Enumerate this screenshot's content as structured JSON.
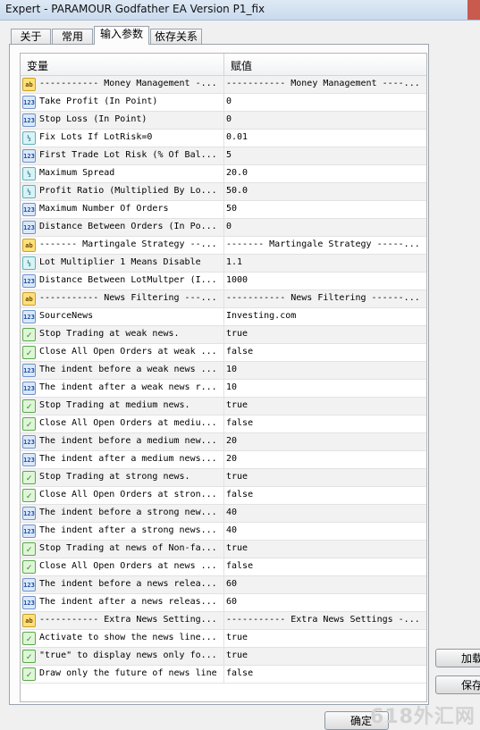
{
  "window": {
    "title": "Expert - PARAMOUR Godfather EA Version P1_fix"
  },
  "tabs": [
    {
      "label": "关于"
    },
    {
      "label": "常用"
    },
    {
      "label": "输入参数",
      "active": true
    },
    {
      "label": "依存关系"
    }
  ],
  "grid": {
    "col_variable": "变量",
    "col_value": "赋值",
    "rows": [
      {
        "icon": "ab",
        "name": "----------- Money Management -...",
        "value": "----------- Money Management ----..."
      },
      {
        "icon": "123",
        "name": "Take Profit (In Point)",
        "value": "0"
      },
      {
        "icon": "123",
        "name": "Stop Loss (In Point)",
        "value": "0"
      },
      {
        "icon": "frac",
        "name": "Fix Lots If LotRisk=0",
        "value": "0.01"
      },
      {
        "icon": "123",
        "name": "First Trade Lot Risk (% Of Bal...",
        "value": "5"
      },
      {
        "icon": "frac",
        "name": "Maximum Spread",
        "value": "20.0"
      },
      {
        "icon": "frac",
        "name": "Profit Ratio (Multiplied By Lo...",
        "value": "50.0"
      },
      {
        "icon": "123",
        "name": "Maximum Number Of Orders",
        "value": "50"
      },
      {
        "icon": "123",
        "name": "Distance Between Orders (In Po...",
        "value": "0"
      },
      {
        "icon": "ab",
        "name": "------- Martingale Strategy --...",
        "value": "------- Martingale Strategy -----..."
      },
      {
        "icon": "frac",
        "name": "Lot Multiplier 1 Means Disable",
        "value": "1.1"
      },
      {
        "icon": "123",
        "name": "Distance Between LotMultper (I...",
        "value": "1000"
      },
      {
        "icon": "ab",
        "name": "----------- News Filtering ---...",
        "value": "----------- News Filtering ------..."
      },
      {
        "icon": "123",
        "name": "SourceNews",
        "value": "Investing.com"
      },
      {
        "icon": "bool",
        "name": "Stop Trading at weak news.",
        "value": "true"
      },
      {
        "icon": "bool",
        "name": "Close All Open Orders at weak ...",
        "value": "false"
      },
      {
        "icon": "123",
        "name": "The indent before a weak news ...",
        "value": "10"
      },
      {
        "icon": "123",
        "name": "The indent after a weak news r...",
        "value": "10"
      },
      {
        "icon": "bool",
        "name": "Stop Trading at medium news.",
        "value": "true"
      },
      {
        "icon": "bool",
        "name": "Close All Open Orders at mediu...",
        "value": "false"
      },
      {
        "icon": "123",
        "name": "The indent before a medium new...",
        "value": "20"
      },
      {
        "icon": "123",
        "name": "The indent after a medium news...",
        "value": "20"
      },
      {
        "icon": "bool",
        "name": "Stop Trading at strong news.",
        "value": "true"
      },
      {
        "icon": "bool",
        "name": "Close All Open Orders at stron...",
        "value": "false"
      },
      {
        "icon": "123",
        "name": "The indent before a strong new...",
        "value": "40"
      },
      {
        "icon": "123",
        "name": "The indent after a strong news...",
        "value": "40"
      },
      {
        "icon": "bool",
        "name": "Stop Trading at news of Non-fa...",
        "value": "true"
      },
      {
        "icon": "bool",
        "name": "Close All Open Orders at news ...",
        "value": "false"
      },
      {
        "icon": "123",
        "name": "The indent before a news relea...",
        "value": "60"
      },
      {
        "icon": "123",
        "name": "The indent after a news releas...",
        "value": "60"
      },
      {
        "icon": "ab",
        "name": "----------- Extra News Setting...",
        "value": "----------- Extra News Settings -..."
      },
      {
        "icon": "bool",
        "name": "Activate to show the news line...",
        "value": "true"
      },
      {
        "icon": "bool",
        "name": "\"true\" to display news only fo...",
        "value": "true"
      },
      {
        "icon": "bool",
        "name": "Draw only the future of news line",
        "value": "false"
      }
    ]
  },
  "buttons": {
    "load": "加载",
    "save": "保存",
    "ok": "确定"
  },
  "watermark": "618外汇网"
}
